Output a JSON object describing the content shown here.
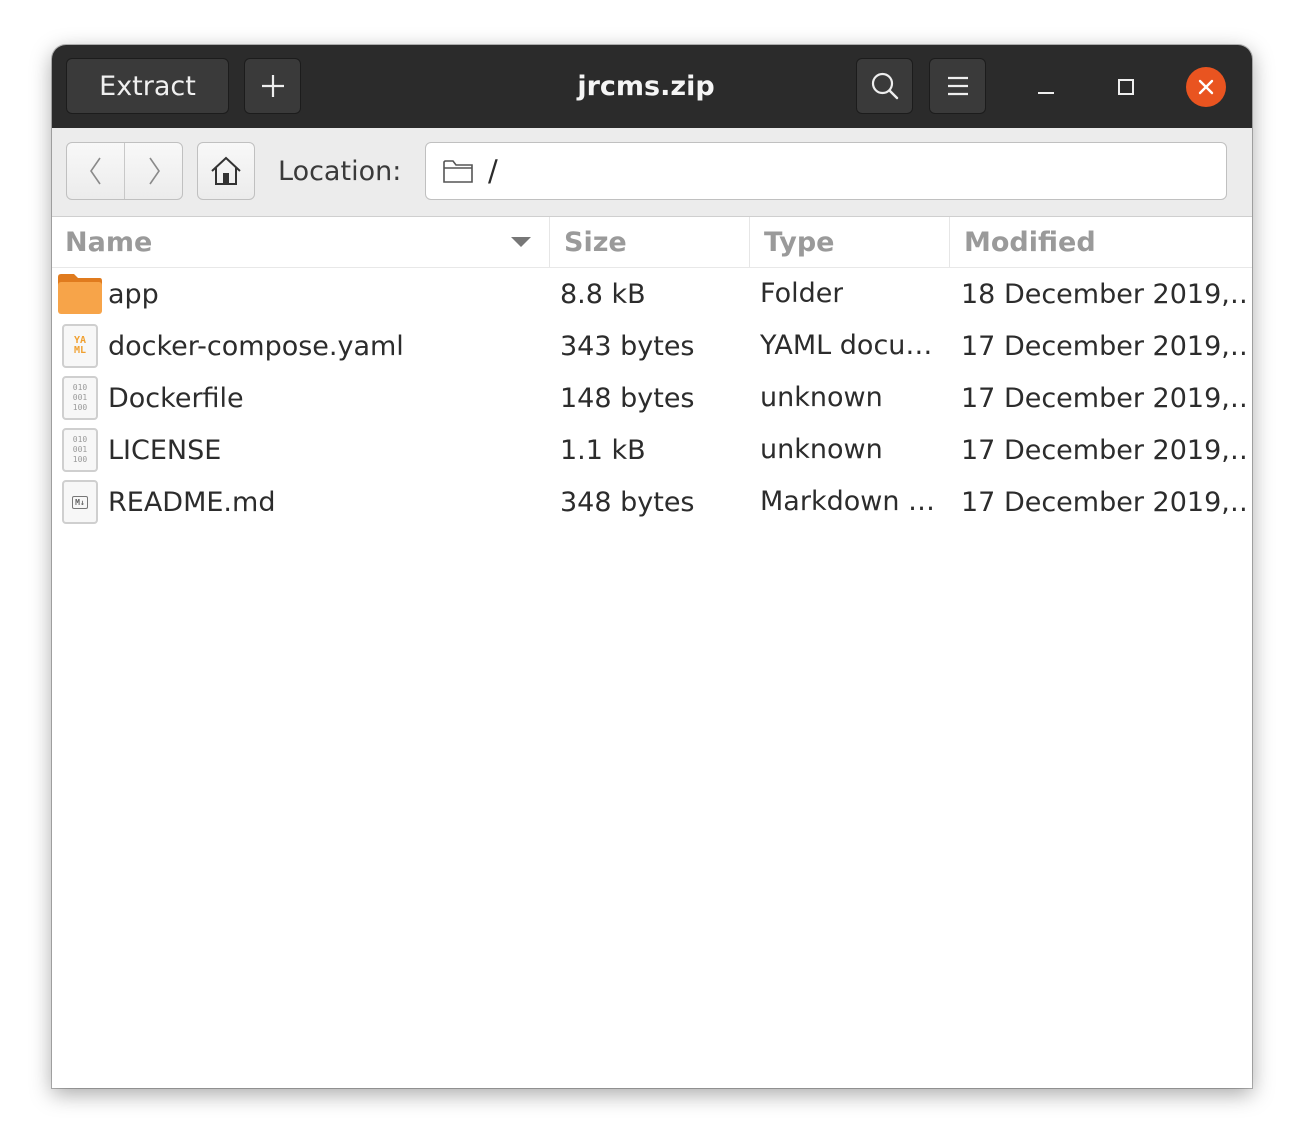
{
  "window": {
    "title": "jrcms.zip"
  },
  "headerbar": {
    "extract_label": "Extract",
    "add_icon": "plus-icon",
    "search_icon": "search-icon",
    "menu_icon": "hamburger-menu-icon",
    "close_color": "#e95420"
  },
  "toolbar": {
    "back_icon": "chevron-left-icon",
    "forward_icon": "chevron-right-icon",
    "home_icon": "home-icon",
    "location_label": "Location:",
    "location_value": "/"
  },
  "columns": {
    "name": "Name",
    "size": "Size",
    "type": "Type",
    "modified": "Modified"
  },
  "files": [
    {
      "name": "app",
      "size": "8.8 kB",
      "type": "Folder",
      "modified": "18 December 2019,…",
      "icon": "folder-icon"
    },
    {
      "name": "docker-compose.yaml",
      "size": "343 bytes",
      "type": "YAML docu…",
      "modified": "17 December 2019,…",
      "icon": "yaml-file-icon"
    },
    {
      "name": "Dockerfile",
      "size": "148 bytes",
      "type": "unknown",
      "modified": "17 December 2019,…",
      "icon": "binary-file-icon"
    },
    {
      "name": "LICENSE",
      "size": "1.1 kB",
      "type": "unknown",
      "modified": "17 December 2019,…",
      "icon": "binary-file-icon"
    },
    {
      "name": "README.md",
      "size": "348 bytes",
      "type": "Markdown …",
      "modified": "17 December 2019,…",
      "icon": "markdown-file-icon"
    }
  ]
}
